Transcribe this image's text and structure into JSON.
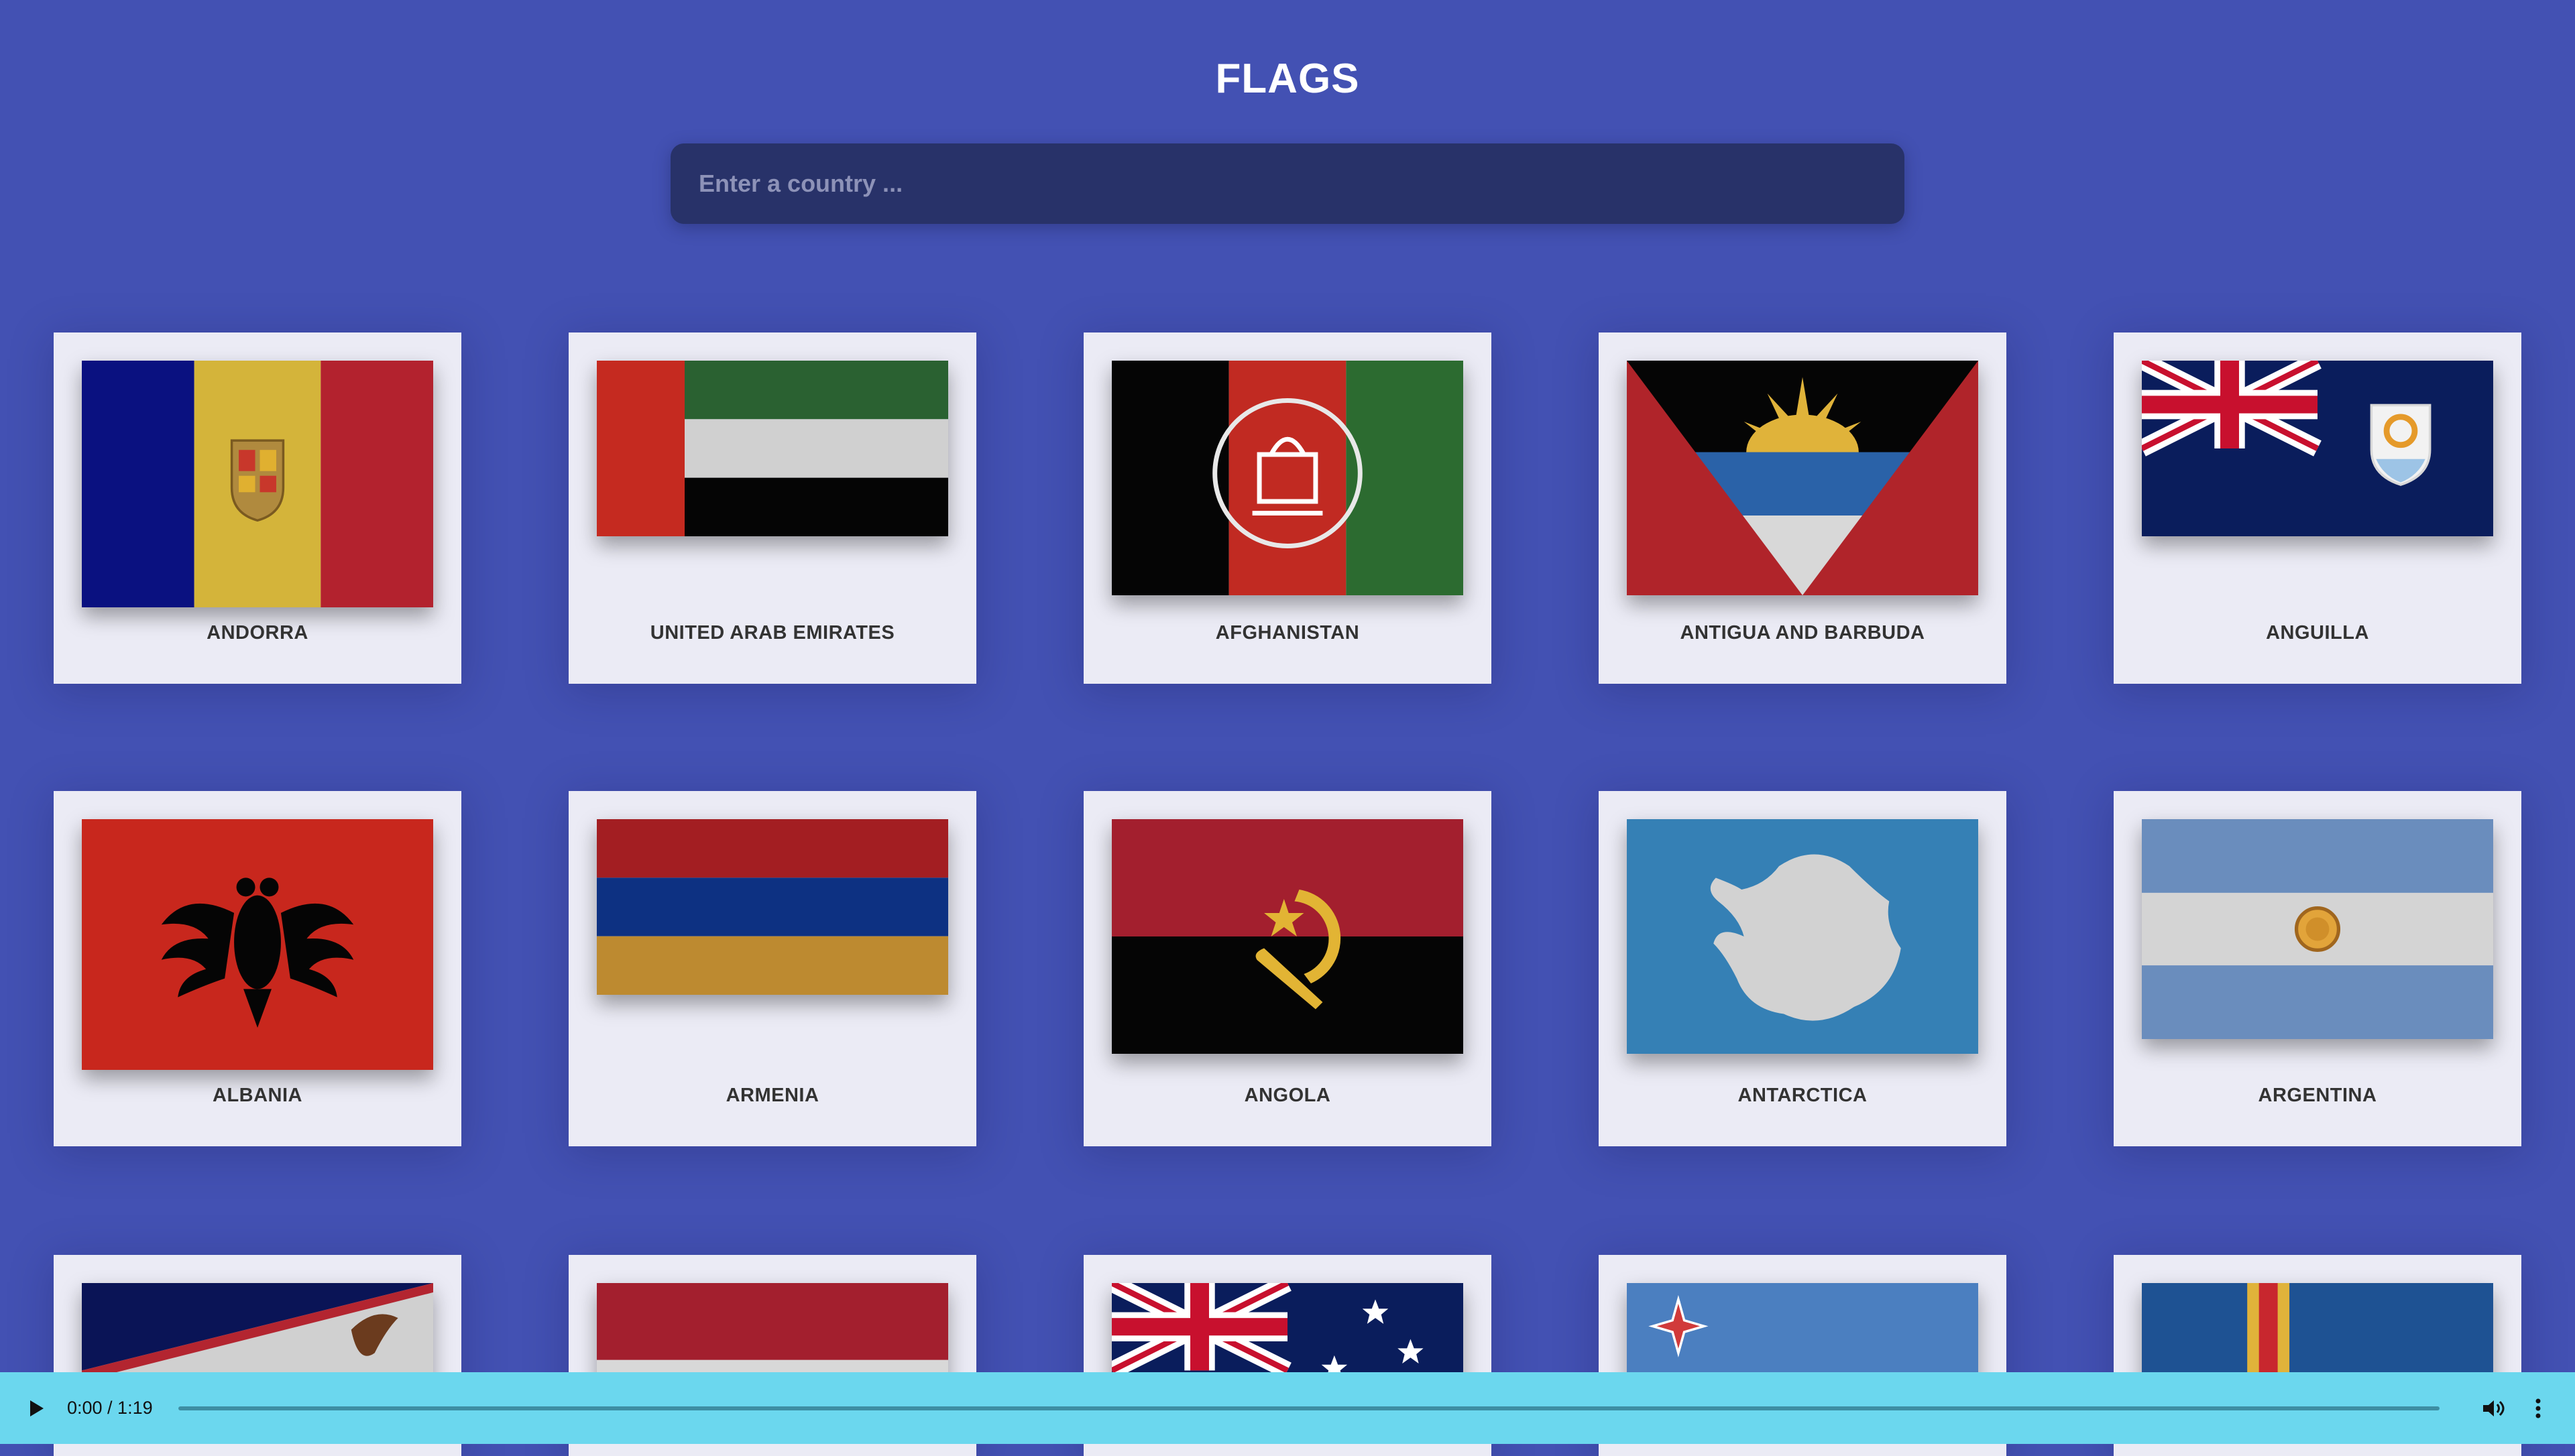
{
  "page": {
    "title": "FLAGS"
  },
  "search": {
    "placeholder": "Enter a country ..."
  },
  "countries": [
    "ANDORRA",
    "UNITED ARAB EMIRATES",
    "AFGHANISTAN",
    "ANTIGUA AND BARBUDA",
    "ANGUILLA",
    "ALBANIA",
    "ARMENIA",
    "ANGOLA",
    "ANTARCTICA",
    "ARGENTINA"
  ],
  "row3_flags": [
    "american-samoa-flag",
    "austria-flag",
    "australia-flag",
    "aruba-flag",
    "aland-islands-flag"
  ],
  "player": {
    "time": "0:00 / 1:19",
    "progress": 0
  },
  "colors": {
    "background": "#4351b3",
    "card": "#ebebf5",
    "search": "#283269",
    "player": "#6bd7ee"
  }
}
